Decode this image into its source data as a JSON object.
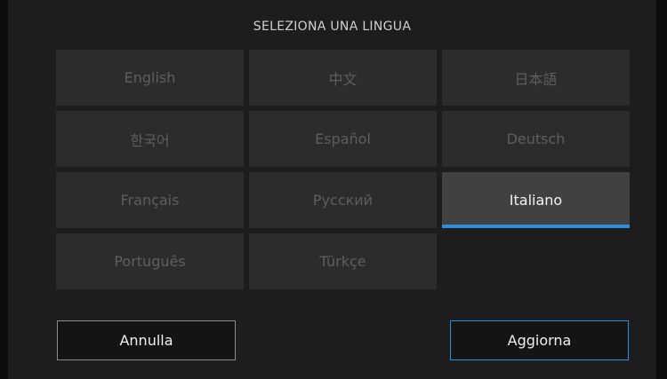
{
  "dialog": {
    "title": "SELEZIONA UNA LINGUA",
    "selected_language": "Italiano",
    "accent_color": "#2b8fe0",
    "languages": [
      {
        "label": "English"
      },
      {
        "label": "中文"
      },
      {
        "label": "日本語"
      },
      {
        "label": "한국어"
      },
      {
        "label": "Español"
      },
      {
        "label": "Deutsch"
      },
      {
        "label": "Français"
      },
      {
        "label": "Русский"
      },
      {
        "label": "Italiano"
      },
      {
        "label": "Português"
      },
      {
        "label": "Türkçe"
      }
    ],
    "cancel_label": "Annulla",
    "update_label": "Aggiorna"
  }
}
